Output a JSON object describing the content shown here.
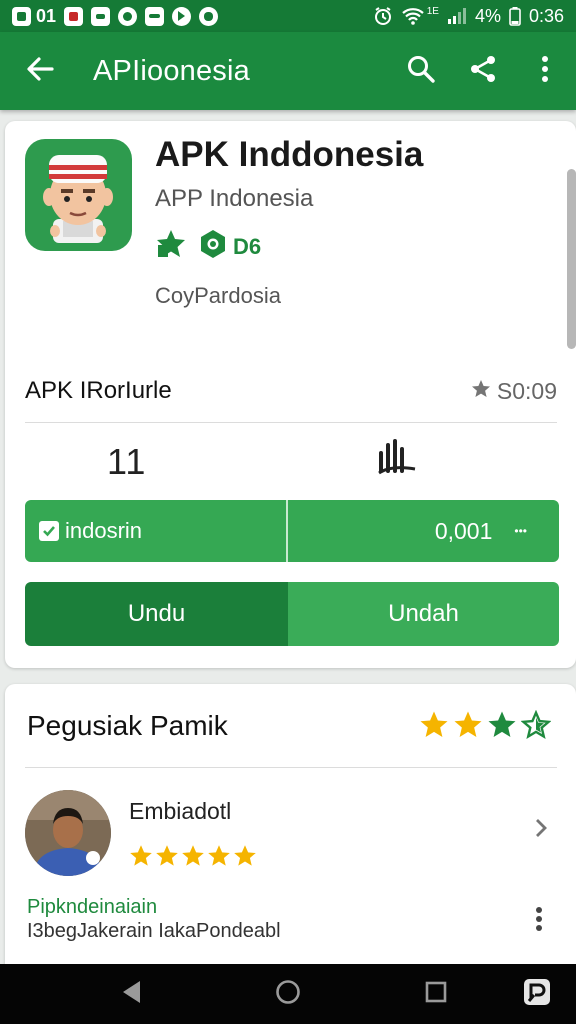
{
  "status_bar": {
    "left_number": "01",
    "battery": "4%",
    "time": "0:36",
    "network_label": "1E"
  },
  "app_bar": {
    "title": "APIioonesia",
    "back_icon": "arrow-left-icon",
    "search_icon": "search-icon",
    "share_icon": "share-icon",
    "more_icon": "more-vert-icon"
  },
  "app": {
    "name": "APK Inddonesia",
    "developer": "APP Indonesia",
    "badge_text": "D6",
    "category": "CoyPardosia",
    "accent": "#1b8a3f"
  },
  "info": {
    "section_title": "APK IRorIurle",
    "rating_value": "S0:09",
    "stat_value": "11"
  },
  "primary_bar": {
    "left_label": "indosrin",
    "right_value": "0,001",
    "right_more": "•••"
  },
  "action_bar": {
    "left_label": "Undu",
    "right_label": "Undah"
  },
  "reviews": {
    "title": "Pegusiak Pamik",
    "header_stars": 3.5,
    "reviewer_name": "Embiadotl",
    "reviewer_stars": 5,
    "line1": "Pipkndeinaiain",
    "line2": "I3begJakerain IakaPondeabl"
  },
  "navbar": {
    "back_icon": "nav-back-icon",
    "home_icon": "nav-home-icon",
    "recents_icon": "nav-recents-icon",
    "extra_icon": "nav-app-icon"
  }
}
